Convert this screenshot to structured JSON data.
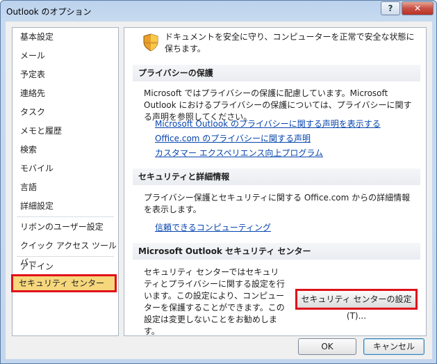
{
  "window": {
    "title": "Outlook のオプション",
    "help_label": "?",
    "close_label": "✕"
  },
  "sidebar": {
    "items": [
      {
        "label": "基本設定"
      },
      {
        "label": "メール"
      },
      {
        "label": "予定表"
      },
      {
        "label": "連絡先"
      },
      {
        "label": "タスク"
      },
      {
        "label": "メモと履歴"
      },
      {
        "label": "検索"
      },
      {
        "label": "モバイル"
      },
      {
        "label": "言語"
      },
      {
        "label": "詳細設定"
      },
      {
        "label": "リボンのユーザー設定"
      },
      {
        "label": "クイック アクセス ツール バー"
      },
      {
        "label": "アドイン"
      },
      {
        "label": "セキュリティ センター"
      }
    ],
    "selected_index": 13
  },
  "main": {
    "intro": "ドキュメントを安全に守り、コンピューターを正常で安全な状態に保ちます。",
    "privacy": {
      "heading": "プライバシーの保護",
      "text": "Microsoft ではプライバシーの保護に配慮しています。Microsoft Outlook におけるプライバシーの保護については、プライバシーに関する声明を参照してください。",
      "links": [
        "Microsoft Outlook のプライバシーに関する声明を表示する",
        "Office.com のプライバシーに関する声明",
        "カスタマー エクスペリエンス向上プログラム"
      ]
    },
    "security_info": {
      "heading": "セキュリティと詳細情報",
      "text": "プライバシー保護とセキュリティに関する Office.com からの詳細情報を表示します。",
      "link": "信頼できるコンピューティング"
    },
    "trust_center": {
      "heading": "Microsoft Outlook セキュリティ センター",
      "text": "セキュリティ センターではセキュリティとプライバシーに関する設定を行います。この設定により、コンピューターを保護することができます。この設定は変更しないことをお勧めします。",
      "button": "セキュリティ センターの設定(T)..."
    }
  },
  "buttons": {
    "ok": "OK",
    "cancel": "キャンセル"
  },
  "colors": {
    "selected_bg": "#f6d77c",
    "highlight_border": "#e0101a",
    "link": "#0645ad"
  }
}
